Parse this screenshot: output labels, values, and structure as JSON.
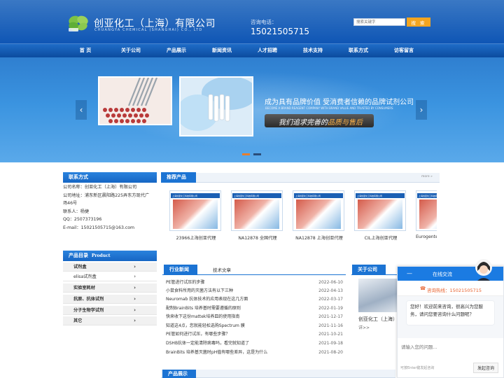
{
  "header": {
    "brand_cn": "创亚化工（上海）有限公司",
    "brand_en": "CHUANGYA CHEMICAL (SHANGHAI) CO., LTD",
    "hotline_label": "咨询电话：",
    "hotline_number": "15021505715",
    "search_placeholder": "搜索关键字",
    "search_button": "搜 索"
  },
  "nav": [
    "首 页",
    "关于公司",
    "产品展示",
    "新闻资讯",
    "人才招聘",
    "技术支持",
    "联系方式",
    "访客留言"
  ],
  "banner": {
    "slogan_main": "成为具有品牌价值 受消费者信赖的品牌试剂公司",
    "slogan_en": "BECOME A BRAND REAGENT COMPANY WITH BRAND VALUE AND TRUSTED BY CONSUMERS",
    "slogan_prefix": "我们追求完善的",
    "slogan_highlight": "品质与售后",
    "slide_count": 2,
    "active_slide": 1
  },
  "contact": {
    "title": "联系方式",
    "lines": [
      "公司名称：创亚化工（上海）有限公司",
      "公司地址：浦东新区晨阳路225弄东方现代广",
      "场46号",
      "联系人：杨捷",
      "QQ：2507373196",
      "E-mail：15021505715@163.com"
    ]
  },
  "categories": {
    "title": "产品目录",
    "title_en": "Product",
    "items": [
      {
        "label": "试剂盒",
        "style": "dark"
      },
      {
        "label": "elisa试剂盒",
        "style": "light"
      },
      {
        "label": "实验室耗材",
        "style": "dark"
      },
      {
        "label": "抗原、抗体试剂",
        "style": "dark"
      },
      {
        "label": "分子生物学试剂",
        "style": "dark"
      },
      {
        "label": "其它",
        "style": "dark"
      }
    ]
  },
  "recommend": {
    "title": "推荐产品",
    "more": "more »",
    "card_caption": "上海创亚化工科技有限公司",
    "items": [
      "23966上海创亚代理",
      "NA12878 全国代理",
      "NA12878 上海创亚代理",
      "CIL上海创亚代理",
      "Eurogentec"
    ]
  },
  "news": {
    "tab_active": "行业新闻",
    "tab_inactive": "技术文章",
    "items": [
      {
        "title": "PE管进行试压的步骤",
        "date": "2022-06-10"
      },
      {
        "title": "小鼠食料所用的灭菌方法有以下三种",
        "date": "2022-04-13"
      },
      {
        "title": "Neuromab 抗体技术的应用表现在这几方面",
        "date": "2022-03-17"
      },
      {
        "title": "配制BrainBits 培养基时需要遵循的原则",
        "date": "2022-01-19"
      },
      {
        "title": "快来收下这份mattek培养皿的使用指南",
        "date": "2021-12-17"
      },
      {
        "title": "知道这4点，您就能轻松选购Spectrum 膜",
        "date": "2021-11-16"
      },
      {
        "title": "PE管如何进行试压，有哪些步骤？",
        "date": "2021-10-21"
      },
      {
        "title": "DSHB抗体一定能清除病毒吗，看完就知道了",
        "date": "2021-09-18"
      },
      {
        "title": "BrainBits 培养基灭菌时pH值有哪些差异，这是为什么",
        "date": "2021-08-20"
      }
    ]
  },
  "about": {
    "title": "关于公司",
    "company": "创亚化工（上海）",
    "more": "详>>"
  },
  "products_section": {
    "title": "产品展示"
  },
  "chat": {
    "header": "在线交流",
    "minimize": "—",
    "phone": "咨询热线：15021505715",
    "message": "您好！欢迎前来咨询，很高兴为您服务，请问您要咨询什么问题呢？",
    "input_placeholder": "请输入您的问题...",
    "hint": "可按Enter键发起咨询",
    "send": "发起咨询"
  },
  "colors": {
    "header_blue": "#1460bd",
    "accent_orange": "#f3a520",
    "section_blue": "#1b73d3",
    "chat_blue": "#1b7be2"
  }
}
